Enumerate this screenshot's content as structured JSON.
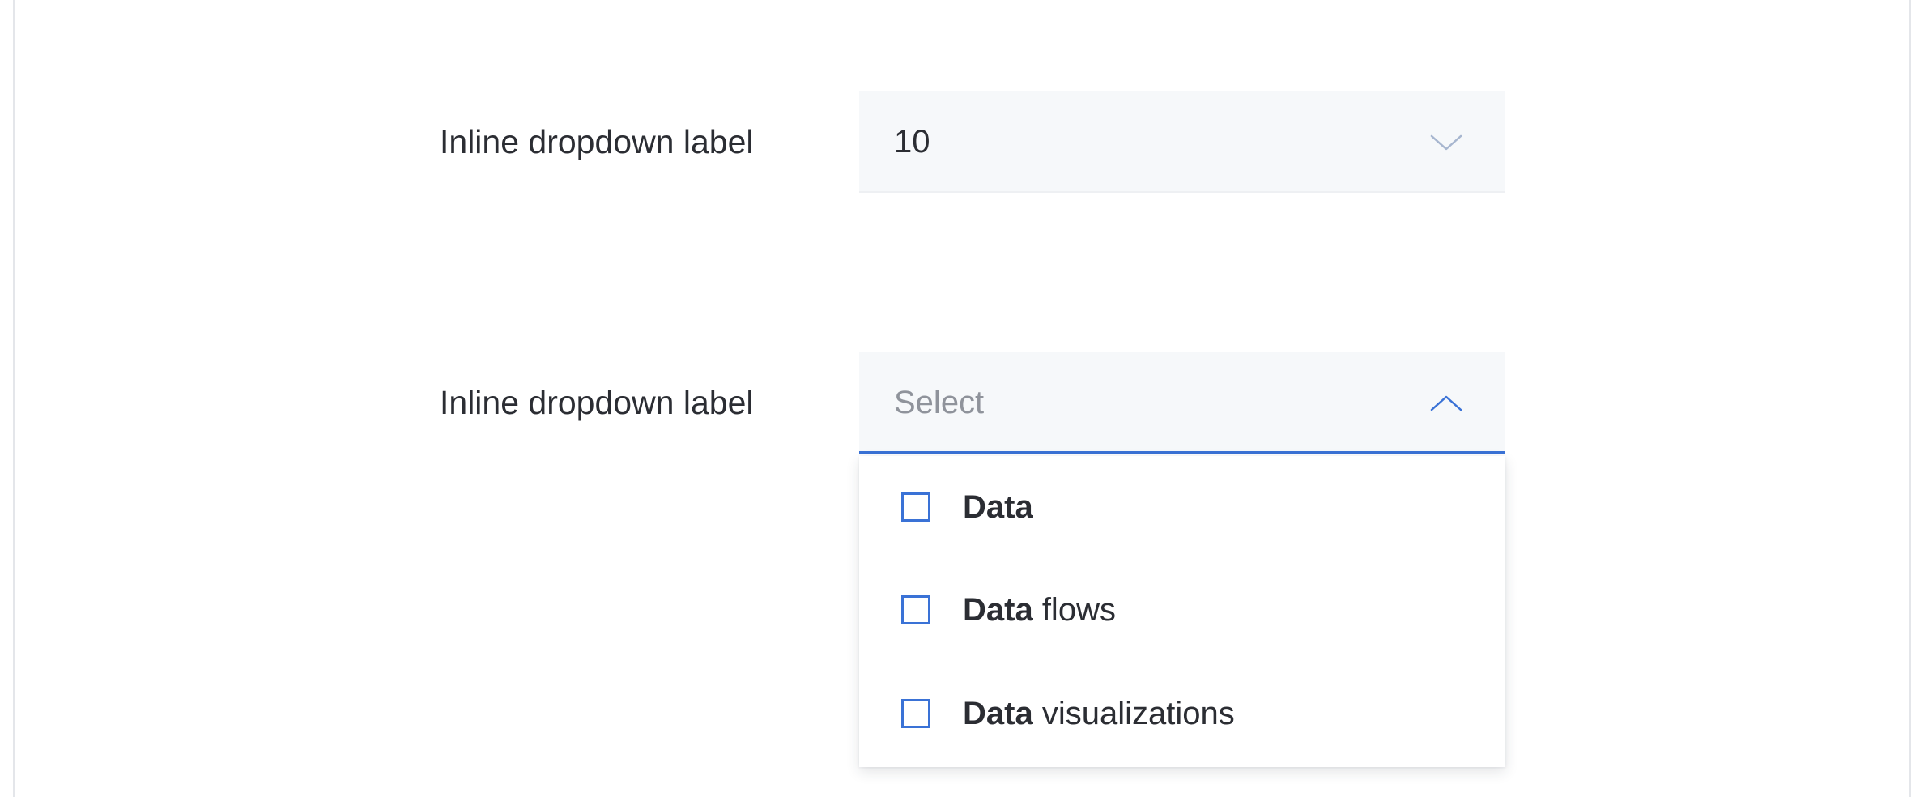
{
  "form": {
    "field1": {
      "label": "Inline dropdown label",
      "value": "10",
      "icon": "chevron-down-icon",
      "expanded": false
    },
    "field2": {
      "label": "Inline dropdown label",
      "placeholder": "Select",
      "icon": "chevron-up-icon",
      "expanded": true,
      "options": [
        {
          "match": "Data",
          "rest": ""
        },
        {
          "match": "Data",
          "rest": " flows"
        },
        {
          "match": "Data",
          "rest": " visualizations"
        }
      ]
    }
  },
  "colors": {
    "accent": "#3a72d6",
    "field_bg": "#f6f8fa",
    "text": "#2b2d33",
    "placeholder": "#8f939b",
    "chevron": "#a7b6cf"
  }
}
